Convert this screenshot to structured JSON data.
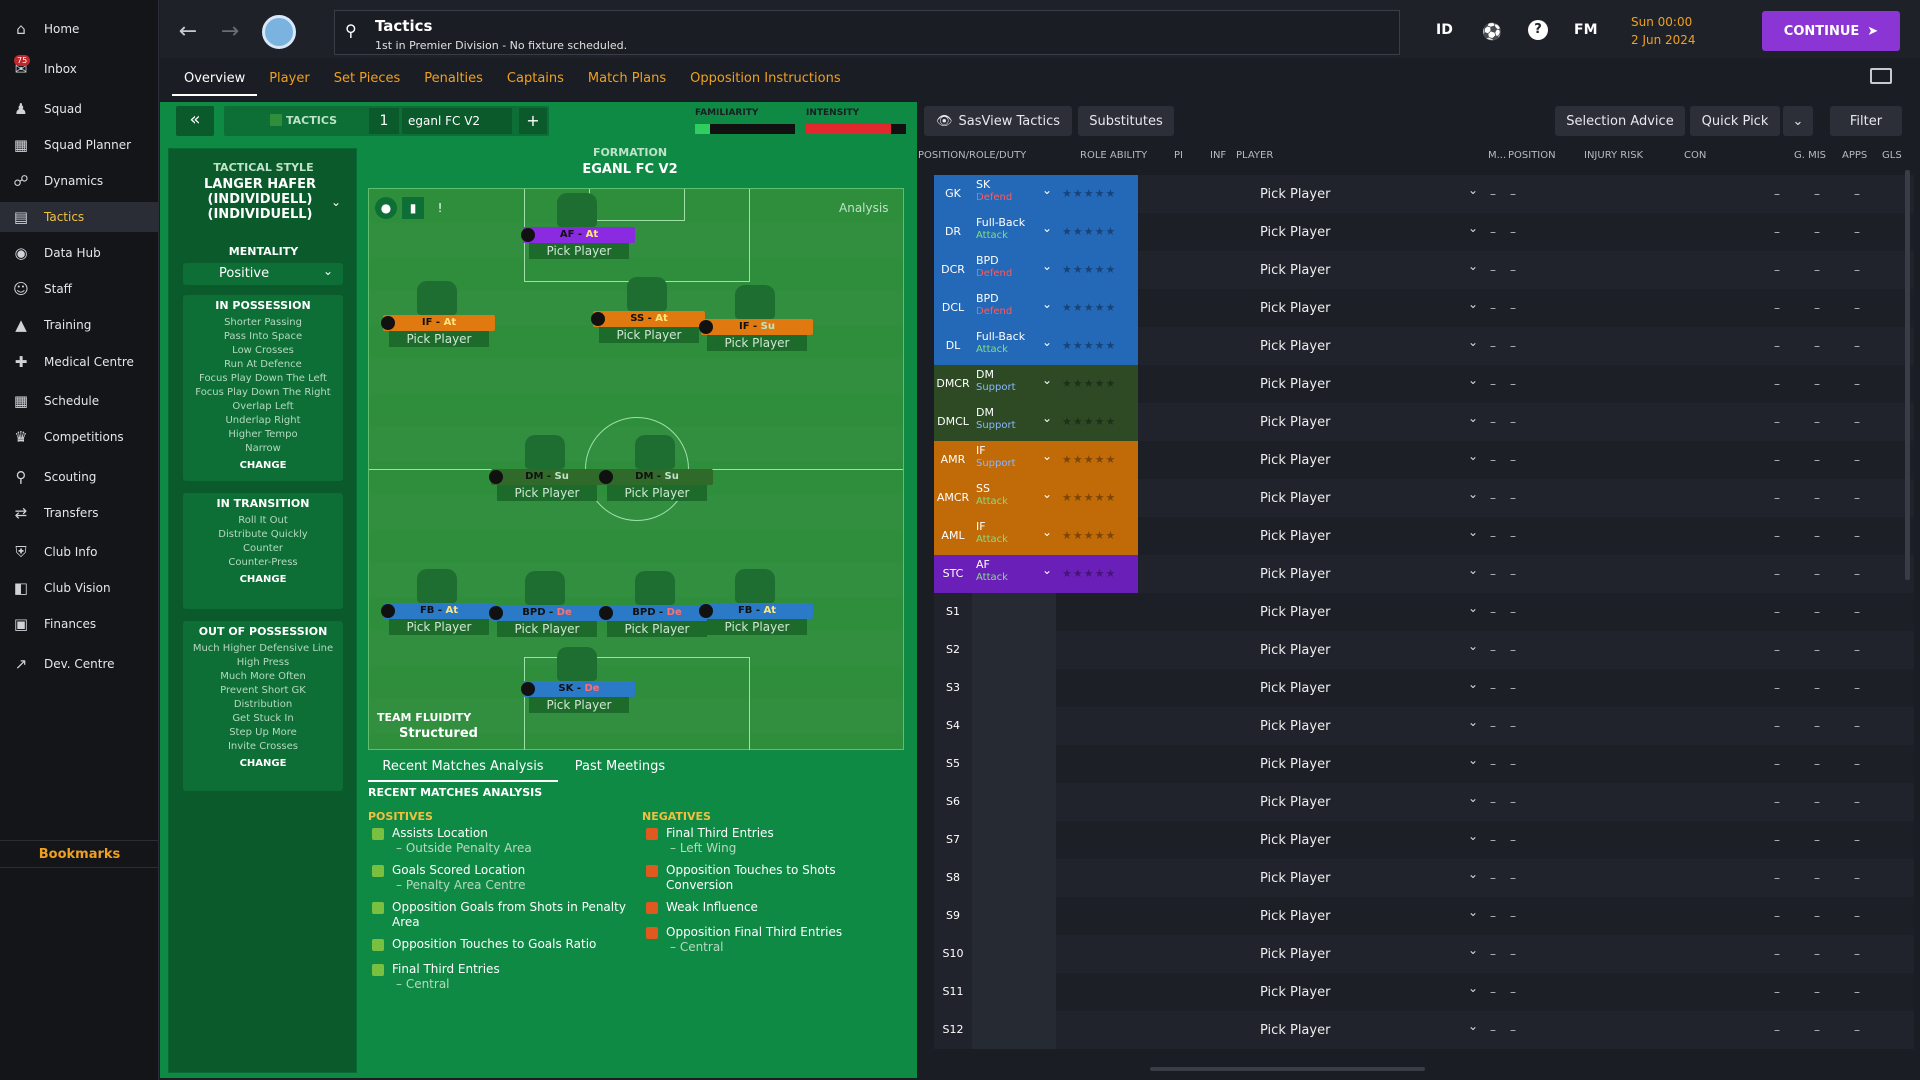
{
  "sidebar": {
    "items": [
      {
        "label": "Home",
        "icon": "home-icon"
      },
      {
        "label": "Inbox",
        "icon": "inbox-icon",
        "badge": "75"
      },
      {
        "label": "Squad",
        "icon": "squad-icon"
      },
      {
        "label": "Squad Planner",
        "icon": "planner-icon"
      },
      {
        "label": "Dynamics",
        "icon": "dynamics-icon"
      },
      {
        "label": "Tactics",
        "icon": "tactics-icon",
        "active": true
      },
      {
        "label": "Data Hub",
        "icon": "data-hub-icon"
      },
      {
        "label": "Staff",
        "icon": "staff-icon"
      },
      {
        "label": "Training",
        "icon": "training-icon"
      },
      {
        "label": "Medical Centre",
        "icon": "medical-icon"
      },
      {
        "label": "Schedule",
        "icon": "calendar-icon"
      },
      {
        "label": "Competitions",
        "icon": "trophy-icon"
      },
      {
        "label": "Scouting",
        "icon": "scouting-icon"
      },
      {
        "label": "Transfers",
        "icon": "transfers-icon"
      },
      {
        "label": "Club Info",
        "icon": "club-info-icon"
      },
      {
        "label": "Club Vision",
        "icon": "club-vision-icon"
      },
      {
        "label": "Finances",
        "icon": "finances-icon"
      },
      {
        "label": "Dev. Centre",
        "icon": "dev-centre-icon"
      }
    ],
    "bookmarks": "Bookmarks"
  },
  "header": {
    "title": "Tactics",
    "subtitle": "1st in Premier Division - No fixture scheduled.",
    "id_label": "ID",
    "fm_label": "FM",
    "time": "Sun 00:00",
    "date": "2 Jun 2024",
    "continue_label": "CONTINUE"
  },
  "tabs": [
    "Overview",
    "Player",
    "Set Pieces",
    "Penalties",
    "Captains",
    "Match Plans",
    "Opposition Instructions"
  ],
  "tactics_bar": {
    "label": "TACTICS",
    "slot": "1",
    "name": "eganl FC V2",
    "familiarity_label": "FAMILIARITY",
    "intensity_label": "INTENSITY",
    "familiarity": 0.15,
    "intensity": 0.85
  },
  "tactical_style": {
    "label": "TACTICAL STYLE",
    "value": "LANGER HAFER (INDIVIDUELL) (INDIVIDUELL)",
    "mentality_label": "MENTALITY",
    "mentality": "Positive"
  },
  "in_possession": {
    "title": "IN POSSESSION",
    "items": [
      "Shorter Passing",
      "Pass Into Space",
      "Low Crosses",
      "Run At Defence",
      "Focus Play Down The Left",
      "Focus Play Down The Right",
      "Overlap Left",
      "Underlap Right",
      "Higher Tempo",
      "Narrow"
    ],
    "change": "CHANGE"
  },
  "in_transition": {
    "title": "IN TRANSITION",
    "items": [
      "Roll It Out",
      "Distribute Quickly",
      "Counter",
      "Counter-Press"
    ],
    "change": "CHANGE"
  },
  "out_of_possession": {
    "title": "OUT OF POSSESSION",
    "items": [
      "Much Higher Defensive Line",
      "High Press",
      "Much More Often",
      "Prevent Short GK",
      "Distribution",
      "Get Stuck In",
      "Step Up More",
      "Invite Crosses"
    ],
    "change": "CHANGE"
  },
  "formation": {
    "label": "FORMATION",
    "name": "EGANL FC V2",
    "analysis": "Analysis",
    "fluidity_label": "TEAM FLUIDITY",
    "fluidity": "Structured"
  },
  "pitch_players": [
    {
      "role": "AF",
      "duty": "At",
      "color": "#8a2be2",
      "pick": "Pick Player"
    },
    {
      "role": "IF",
      "duty": "At",
      "color": "#e07a10",
      "pick": "Pick Player"
    },
    {
      "role": "SS",
      "duty": "At",
      "color": "#e07a10",
      "pick": "Pick Player"
    },
    {
      "role": "IF",
      "duty": "Su",
      "color": "#e07a10",
      "pick": "Pick Player"
    },
    {
      "role": "DM",
      "duty": "Su",
      "color": "#2f6a2a",
      "pick": "Pick Player"
    },
    {
      "role": "DM",
      "duty": "Su",
      "color": "#2f6a2a",
      "pick": "Pick Player"
    },
    {
      "role": "FB",
      "duty": "At",
      "color": "#2a7ac8",
      "pick": "Pick Player"
    },
    {
      "role": "BPD",
      "duty": "De",
      "color": "#2a7ac8",
      "pick": "Pick Player"
    },
    {
      "role": "BPD",
      "duty": "De",
      "color": "#2a7ac8",
      "pick": "Pick Player"
    },
    {
      "role": "FB",
      "duty": "At",
      "color": "#2a7ac8",
      "pick": "Pick Player"
    },
    {
      "role": "SK",
      "duty": "De",
      "color": "#2a7ac8",
      "pick": "Pick Player"
    }
  ],
  "analysis": {
    "tabs": [
      "Recent Matches Analysis",
      "Past Meetings"
    ],
    "heading": "RECENT MATCHES ANALYSIS",
    "positives_label": "POSITIVES",
    "negatives_label": "NEGATIVES",
    "positives": [
      [
        "Assists Location",
        "– Outside Penalty Area"
      ],
      [
        "Goals Scored Location",
        "– Penalty Area Centre"
      ],
      [
        "Opposition Goals from Shots in Penalty",
        "Area"
      ],
      [
        "Opposition Touches to Goals Ratio",
        ""
      ],
      [
        "Final Third Entries",
        "– Central"
      ]
    ],
    "negatives": [
      [
        "Final Third Entries",
        "– Left Wing"
      ],
      [
        "Opposition Touches to Shots",
        "Conversion"
      ],
      [
        "Weak Influence",
        ""
      ],
      [
        "Opposition Final Third Entries",
        "– Central"
      ]
    ]
  },
  "right_toolbar": {
    "view": "SasView Tactics",
    "substitutes": "Substitutes",
    "selection_advice": "Selection Advice",
    "quick_pick": "Quick Pick",
    "filter": "Filter"
  },
  "columns": [
    "POSITION/ROLE/DUTY",
    "ROLE ABILITY",
    "PI",
    "INF",
    "PLAYER",
    "M...",
    "POSITION",
    "INJURY RISK",
    "CON",
    "G. MIS",
    "APPS",
    "GLS"
  ],
  "rows": [
    {
      "pos": "GK",
      "role": "SK",
      "duty": "Defend",
      "color": "#2468b8",
      "dutycolor": "#ff5a5a"
    },
    {
      "pos": "DR",
      "role": "Full-Back",
      "duty": "Attack",
      "color": "#2468b8",
      "dutycolor": "#7ee07e"
    },
    {
      "pos": "DCR",
      "role": "BPD",
      "duty": "Defend",
      "color": "#2468b8",
      "dutycolor": "#ff5a5a"
    },
    {
      "pos": "DCL",
      "role": "BPD",
      "duty": "Defend",
      "color": "#2468b8",
      "dutycolor": "#ff5a5a"
    },
    {
      "pos": "DL",
      "role": "Full-Back",
      "duty": "Attack",
      "color": "#2468b8",
      "dutycolor": "#7ee07e"
    },
    {
      "pos": "DMCR",
      "role": "DM",
      "duty": "Support",
      "color": "#2d4a25",
      "dutycolor": "#8ab8ff"
    },
    {
      "pos": "DMCL",
      "role": "DM",
      "duty": "Support",
      "color": "#2d4a25",
      "dutycolor": "#8ab8ff"
    },
    {
      "pos": "AMR",
      "role": "IF",
      "duty": "Support",
      "color": "#c06a08",
      "dutycolor": "#8ab8ff"
    },
    {
      "pos": "AMCR",
      "role": "SS",
      "duty": "Attack",
      "color": "#c06a08",
      "dutycolor": "#7ee07e"
    },
    {
      "pos": "AML",
      "role": "IF",
      "duty": "Attack",
      "color": "#c06a08",
      "dutycolor": "#7ee07e"
    },
    {
      "pos": "STC",
      "role": "AF",
      "duty": "Attack",
      "color": "#6a1fb8",
      "dutycolor": "#7ee07e"
    },
    {
      "pos": "S1"
    },
    {
      "pos": "S2"
    },
    {
      "pos": "S3"
    },
    {
      "pos": "S4"
    },
    {
      "pos": "S5"
    },
    {
      "pos": "S6"
    },
    {
      "pos": "S7"
    },
    {
      "pos": "S8"
    },
    {
      "pos": "S9"
    },
    {
      "pos": "S10"
    },
    {
      "pos": "S11"
    },
    {
      "pos": "S12"
    }
  ],
  "pick_label": "Pick Player",
  "dash": "–"
}
